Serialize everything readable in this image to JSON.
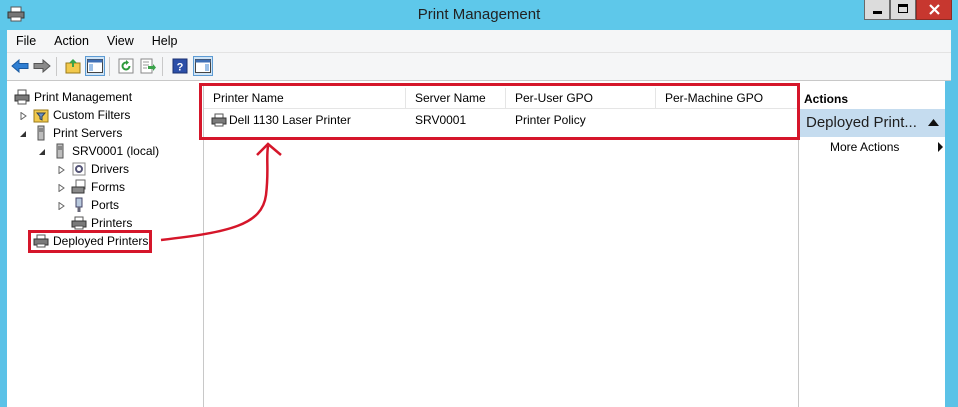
{
  "window": {
    "title": "Print Management"
  },
  "menu": [
    "File",
    "Action",
    "View",
    "Help"
  ],
  "tree": {
    "root": "Print Management",
    "custom_filters": "Custom Filters",
    "print_servers": "Print Servers",
    "server": "SRV0001 (local)",
    "drivers": "Drivers",
    "forms": "Forms",
    "ports": "Ports",
    "printers": "Printers",
    "deployed_printers": "Deployed Printers"
  },
  "list": {
    "columns": [
      "Printer Name",
      "Server Name",
      "Per-User GPO",
      "Per-Machine GPO"
    ],
    "rows": [
      {
        "printer_name": "Dell 1130 Laser Printer",
        "server_name": "SRV0001",
        "per_user_gpo": "Printer Policy",
        "per_machine_gpo": ""
      }
    ]
  },
  "actions": {
    "title": "Actions",
    "group": "Deployed Print...",
    "more": "More Actions"
  },
  "colors": {
    "titlebar": "#5ec8ea",
    "highlight": "#d5162a",
    "action_group": "#c5dcef"
  }
}
